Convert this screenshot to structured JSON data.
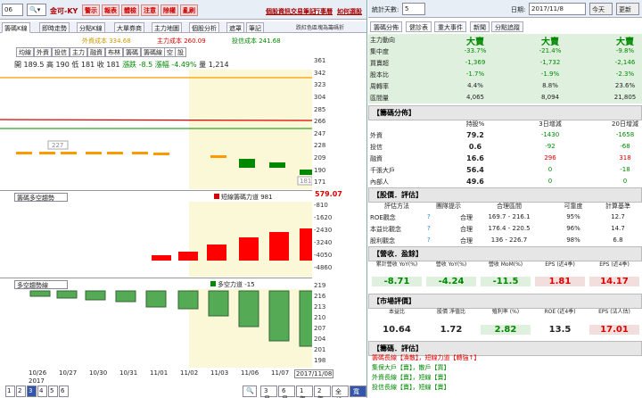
{
  "top": {
    "code": "06",
    "name": "金可-KY",
    "buttons": [
      "警示",
      "報表",
      "體檢",
      "注意",
      "除權",
      "亂刷"
    ],
    "links": [
      "個股資訊",
      "交易筆記",
      "行事曆",
      "如何選股"
    ]
  },
  "tabs": [
    "籌碼K線",
    "即時走勢",
    "分點K線",
    "大單券商",
    "主力地圖",
    "個股分析",
    "遮罩",
    "筆記"
  ],
  "indicator_tabs": [
    "均線",
    "外資",
    "投信",
    "主力",
    "融資",
    "布林",
    "籌碼",
    "籌碼線",
    "空",
    "設"
  ],
  "legend": {
    "foreign": "外資成本 334.68",
    "main": "主力成本 260.09",
    "trust": "投信成本 241.68",
    "note": "跌紅色區塊為籌碼折"
  },
  "ohlc": {
    "text": "開 189.5 高 190 低 181 收 181",
    "chg": "漲跌 -8.5",
    "pct": "漲幅 -4.49%",
    "vol": "量 1,214"
  },
  "axis1": [
    "361",
    "342",
    "323",
    "304",
    "285",
    "266",
    "247",
    "228",
    "209",
    "190",
    "171"
  ],
  "labels1": {
    "left": "227",
    "right": "181"
  },
  "panel2": {
    "select": "籌碼多空趨勢",
    "legend": "短線籌碼力道 981",
    "value": "579.07",
    "axis": [
      "-810",
      "-1620",
      "-2430",
      "-3240",
      "-4050",
      "-4860"
    ]
  },
  "panel3": {
    "select": "多空趨勢線",
    "legend": "多空力道 -15",
    "axis": [
      "219",
      "216",
      "213",
      "210",
      "207",
      "204",
      "201",
      "198"
    ]
  },
  "xaxis": [
    "10/26",
    "10/27",
    "10/30",
    "10/31",
    "11/01",
    "11/02",
    "11/03",
    "11/06",
    "11/07"
  ],
  "xyear": "2017",
  "xlast": "2017/11/08",
  "pages": [
    "1",
    "2",
    "3",
    "4",
    "5",
    "6"
  ],
  "ranges": [
    "3月",
    "6月",
    "1年",
    "2年",
    "全部",
    "寬縮"
  ],
  "right": {
    "days_label": "統計天數:",
    "days": "5",
    "date_label": "日期:",
    "date": "2017/11/8",
    "today": "今天",
    "refresh": "更新",
    "tabs": [
      "籌碼分佈",
      "健診表",
      "重大事件",
      "新聞",
      "分點追蹤"
    ],
    "main": {
      "rows": [
        {
          "k": "主力動向",
          "v": [
            "大賣",
            "大賣",
            "大賣"
          ]
        },
        {
          "k": "集中度",
          "v": [
            "-33.7%",
            "-21.4%",
            "-9.8%"
          ]
        },
        {
          "k": "買賣超",
          "v": [
            "-1,369",
            "-1,732",
            "-2,146"
          ]
        },
        {
          "k": "股本比",
          "v": [
            "-1.7%",
            "-1.9%",
            "-2.3%"
          ]
        },
        {
          "k": "周轉率",
          "v": [
            "4.4%",
            "8.8%",
            "23.6%"
          ]
        },
        {
          "k": "區間量",
          "v": [
            "4,065",
            "8,094",
            "21,805"
          ]
        }
      ]
    },
    "dist": {
      "title": "【籌碼分佈】",
      "h": [
        "持股%",
        "3日增減",
        "20日增減"
      ],
      "rows": [
        {
          "k": "外資",
          "v": [
            "79.2",
            "-1430",
            "-1658"
          ]
        },
        {
          "k": "投信",
          "v": [
            "0.6",
            "-92",
            "-68"
          ]
        },
        {
          "k": "融資",
          "v": [
            "16.6",
            "296",
            "318"
          ]
        },
        {
          "k": "千張大戶",
          "v": [
            "56.4",
            "0",
            "-18"
          ]
        },
        {
          "k": "內部人",
          "v": [
            "49.6",
            "0",
            "0"
          ]
        }
      ]
    },
    "val": {
      "title": "【股價．評估】",
      "h": [
        "評估方法",
        "團隊提示",
        "合理區間",
        "可靠度",
        "計算基準"
      ],
      "rows": [
        {
          "k": "ROE觀念",
          "v": [
            "合理",
            "169.7 - 216.1",
            "95%",
            "12.7"
          ]
        },
        {
          "k": "本益比觀念",
          "v": [
            "合理",
            "176.4 - 220.5",
            "96%",
            "14.7"
          ]
        },
        {
          "k": "股利觀念",
          "v": [
            "合理",
            "136 - 226.7",
            "98%",
            "6.8"
          ]
        }
      ]
    },
    "rev": {
      "title": "【營收．盈餘】",
      "h": [
        "累計營收 YoY(%)",
        "營收 YoY(%)",
        "營收 MoM(%)",
        "EPS (近4季)",
        "EPS (近4季)"
      ],
      "v": [
        "-8.71",
        "-4.24",
        "-11.5",
        "1.81",
        "14.17"
      ]
    },
    "mkt": {
      "title": "【市場評價】",
      "h": [
        "本益比",
        "股價 淨值比",
        "殖利率 (%)",
        "ROE (近4季)",
        "EPS (法人估)"
      ],
      "v": [
        "10.64",
        "1.72",
        "2.82",
        "13.5",
        "17.01"
      ]
    },
    "chip": {
      "title": "【籌碼．評估】",
      "lines": [
        "籌碼長線【渙散】，短線力道【轉強↑】",
        "集保大戶【賣】，散戶【買】",
        "外資長線【賣】，短線【賣】",
        "投信長線【賣】，短線【賣】"
      ]
    }
  }
}
